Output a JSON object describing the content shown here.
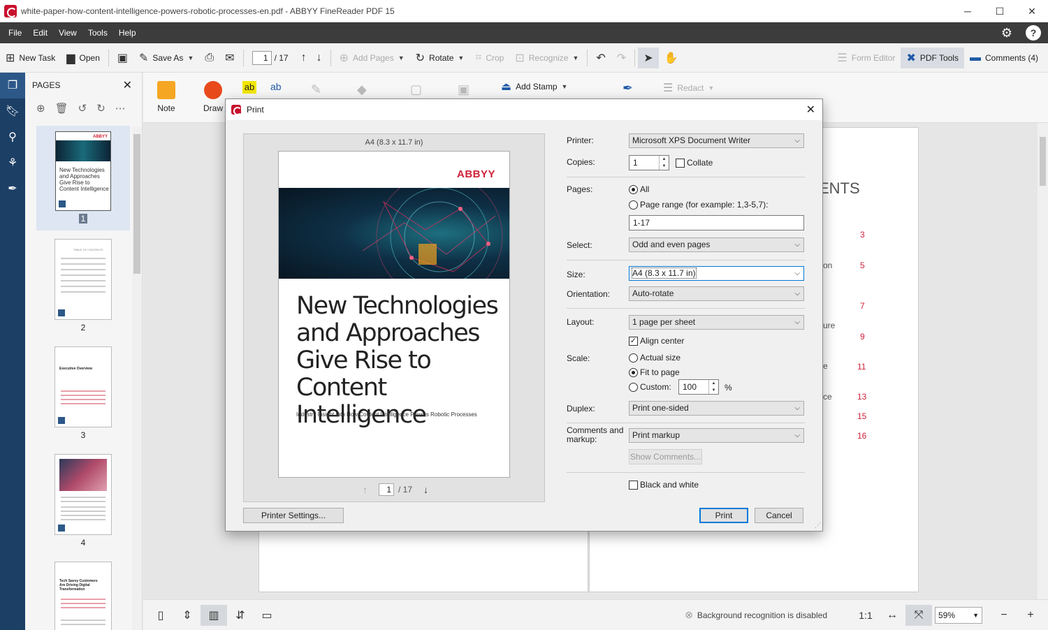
{
  "window": {
    "title": "white-paper-how-content-intelligence-powers-robotic-processes-en.pdf - ABBYY FineReader PDF 15",
    "controls": [
      "─",
      "☐",
      "✕"
    ]
  },
  "menu": [
    "File",
    "Edit",
    "View",
    "Tools",
    "Help"
  ],
  "toolbar": {
    "new_task": "New Task",
    "open": "Open",
    "save_as": "Save As",
    "page_current": "1",
    "page_total": "/ 17",
    "add_pages": "Add Pages",
    "rotate": "Rotate",
    "crop": "Crop",
    "recognize": "Recognize",
    "form_editor": "Form Editor",
    "pdf_tools": "PDF Tools",
    "comments": "Comments (4)"
  },
  "pages_panel": {
    "title": "PAGES",
    "thumbnails": [
      {
        "num": "1",
        "title": "New Technologies and Approaches Give Rise to Content Intelligence"
      },
      {
        "num": "2",
        "title": "TABLE OF CONTENTS"
      },
      {
        "num": "3",
        "title": "Executive Overview"
      },
      {
        "num": "4",
        "title": ""
      },
      {
        "num": "",
        "title": "Tech Savvy Customers Are Driving Digital Transformation"
      }
    ]
  },
  "ribbon": {
    "note": "Note",
    "draw": "Draw",
    "add_stamp": "Add Stamp",
    "redact": "Redact"
  },
  "document": {
    "toc_fragments": [
      "ENTS",
      "on",
      "ure",
      "e",
      "ce"
    ],
    "toc_numbers": [
      "3",
      "5",
      "7",
      "9",
      "11",
      "13",
      "15",
      "16"
    ]
  },
  "statusbar": {
    "background_recognition": "Background recognition is disabled",
    "one_to_one": "1:1",
    "zoom": "59%"
  },
  "print_dialog": {
    "title": "Print",
    "preview": {
      "size_label": "A4 (8.3 x 11.7 in)",
      "logo": "ABBYY",
      "heading_lines": [
        "New Technologies",
        "and Approaches",
        "Give Rise to",
        "Content Intelligence"
      ],
      "subtitle": "Industry Insight Into How Content Intelligence Powers Robotic Processes",
      "page_current": "1",
      "page_total": "/ 17"
    },
    "printer_label": "Printer:",
    "printer_value": "Microsoft XPS Document Writer",
    "copies_label": "Copies:",
    "copies_value": "1",
    "collate_label": "Collate",
    "pages_label": "Pages:",
    "pages_all": "All",
    "pages_range_label": "Page range (for example: 1,3-5,7):",
    "pages_range_value": "1-17",
    "select_label": "Select:",
    "select_value": "Odd and even pages",
    "size_label": "Size:",
    "size_value": "A4 (8.3 x 11.7 in)",
    "orientation_label": "Orientation:",
    "orientation_value": "Auto-rotate",
    "layout_label": "Layout:",
    "layout_value": "1 page per sheet",
    "align_center_label": "Align center",
    "scale_label": "Scale:",
    "scale_actual": "Actual size",
    "scale_fit": "Fit to page",
    "scale_custom": "Custom:",
    "scale_custom_value": "100",
    "percent": "%",
    "duplex_label": "Duplex:",
    "duplex_value": "Print one-sided",
    "comments_label_1": "Comments and",
    "comments_label_2": "markup:",
    "comments_value": "Print markup",
    "show_comments": "Show Comments...",
    "black_white": "Black and white",
    "printer_settings": "Printer Settings...",
    "print": "Print",
    "cancel": "Cancel"
  },
  "colors": {
    "accent": "#0078d7",
    "brand_red": "#d0213a",
    "rail": "#1c3f66",
    "menubar": "#3c3c3c"
  }
}
